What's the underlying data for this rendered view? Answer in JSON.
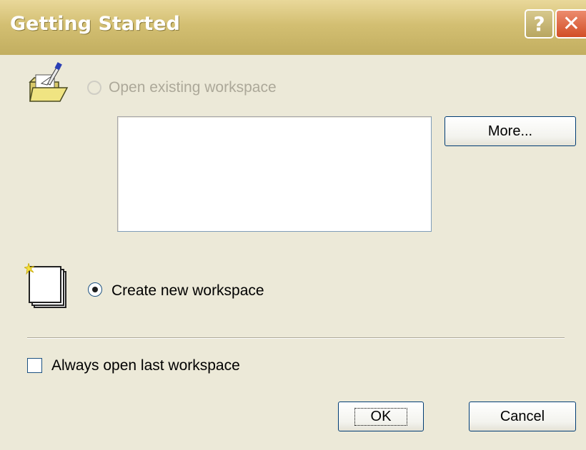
{
  "window": {
    "title": "Getting Started",
    "help_button_label": "?",
    "close_button_label": "✕"
  },
  "open_existing": {
    "label": "Open existing workspace",
    "enabled": false,
    "selected": false,
    "icon": "open-folder-icon"
  },
  "workspace_list": {
    "items": []
  },
  "more_button": {
    "label": "More..."
  },
  "create_new": {
    "label": "Create new workspace",
    "enabled": true,
    "selected": true,
    "icon": "new-document-icon"
  },
  "always_open_last": {
    "label": "Always open last workspace",
    "checked": false
  },
  "buttons": {
    "ok": "OK",
    "cancel": "Cancel"
  }
}
